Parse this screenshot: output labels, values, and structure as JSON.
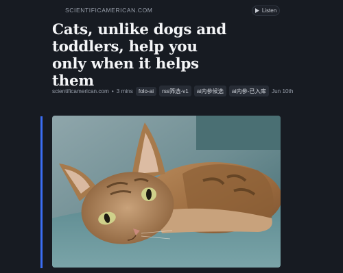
{
  "header": {
    "source": "SCIENTIFICAMERICAN.COM",
    "listen_label": "Listen",
    "listen_icon": "play-icon"
  },
  "article": {
    "title": "Cats, unlike dogs and toddlers, help you only when it helps them",
    "meta": {
      "site": "scientificamerican.com",
      "separator": "•",
      "read_time": "3 mins",
      "tags": [
        "folo-ai",
        "rss筛选-v1",
        "ai内参候选",
        "ai内参-已入库"
      ],
      "date": "Jun 10th"
    }
  },
  "colors": {
    "background": "#171b22",
    "accent": "#3b6ef5",
    "tag_bg": "#272c35"
  }
}
